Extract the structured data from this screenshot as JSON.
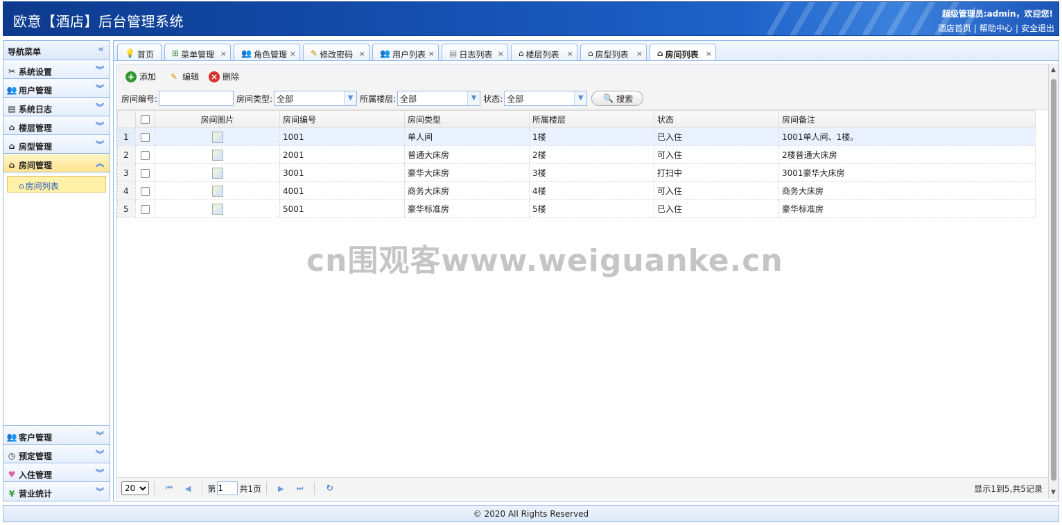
{
  "header": {
    "title": "欧意【酒店】后台管理系统",
    "welcome": "超级管理员:admin，欢迎您!",
    "links": [
      "酒店首页",
      "帮助中心",
      "安全退出"
    ]
  },
  "sidebar": {
    "title": "导航菜单",
    "top_items": [
      {
        "label": "系统设置",
        "icon": "tools-icon"
      },
      {
        "label": "用户管理",
        "icon": "users-icon"
      },
      {
        "label": "系统日志",
        "icon": "log-icon"
      },
      {
        "label": "楼层管理",
        "icon": "house-icon"
      },
      {
        "label": "房型管理",
        "icon": "house-icon"
      },
      {
        "label": "房间管理",
        "icon": "house-icon",
        "active": true
      }
    ],
    "sub_item": "房间列表",
    "bottom_items": [
      {
        "label": "客户管理",
        "icon": "customers-icon"
      },
      {
        "label": "预定管理",
        "icon": "clock-icon"
      },
      {
        "label": "入住管理",
        "icon": "heart-icon"
      },
      {
        "label": "营业统计",
        "icon": "yen-icon"
      }
    ]
  },
  "tabs": [
    {
      "label": "首页",
      "closable": false
    },
    {
      "label": "菜单管理",
      "closable": true
    },
    {
      "label": "角色管理",
      "closable": true
    },
    {
      "label": "修改密码",
      "closable": true
    },
    {
      "label": "用户列表",
      "closable": true
    },
    {
      "label": "日志列表",
      "closable": true
    },
    {
      "label": "楼层列表",
      "closable": true
    },
    {
      "label": "房型列表",
      "closable": true
    },
    {
      "label": "房间列表",
      "closable": true,
      "active": true
    }
  ],
  "toolbar": {
    "add": "添加",
    "edit": "编辑",
    "delete": "删除"
  },
  "search": {
    "room_no_label": "房间编号:",
    "room_no_value": "",
    "room_type_label": "房间类型:",
    "room_type_value": "全部",
    "floor_label": "所属楼层:",
    "floor_value": "全部",
    "status_label": "状态:",
    "status_value": "全部",
    "search_button": "搜索"
  },
  "grid": {
    "columns": [
      "房间图片",
      "房间编号",
      "房间类型",
      "所属楼层",
      "状态",
      "房间备注"
    ],
    "rows": [
      {
        "n": "1",
        "no": "1001",
        "type": "单人间",
        "floor": "1楼",
        "status": "已入住",
        "note": "1001单人间、1楼。"
      },
      {
        "n": "2",
        "no": "2001",
        "type": "普通大床房",
        "floor": "2楼",
        "status": "可入住",
        "note": "2楼普通大床房"
      },
      {
        "n": "3",
        "no": "3001",
        "type": "豪华大床房",
        "floor": "3楼",
        "status": "打扫中",
        "note": "3001豪华大床房"
      },
      {
        "n": "4",
        "no": "4001",
        "type": "商务大床房",
        "floor": "4楼",
        "status": "可入住",
        "note": "商务大床房"
      },
      {
        "n": "5",
        "no": "5001",
        "type": "豪华标准房",
        "floor": "5楼",
        "status": "已入住",
        "note": "豪华标准房"
      }
    ]
  },
  "pager": {
    "page_size": "20",
    "page_prefix": "第",
    "page_value": "1",
    "page_total": "共1页",
    "info": "显示1到5,共5记录"
  },
  "footer": "© 2020 All Rights Reserved",
  "watermark": "cn围观客www.weiguanke.cn"
}
